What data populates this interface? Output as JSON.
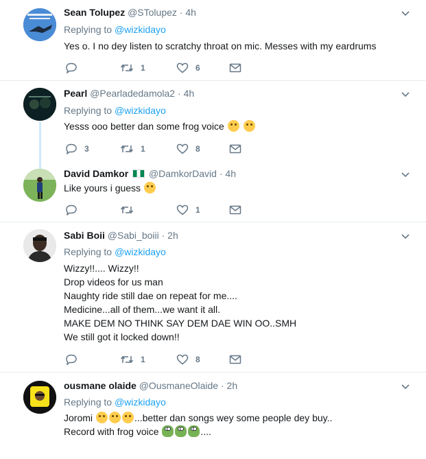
{
  "tweets": [
    {
      "name": "Sean Tolupez",
      "handle": "@STolupez",
      "time": "4h",
      "replying_label": "Replying to",
      "replying_to": "@wizkidayo",
      "lines": [
        "Yes o. I no dey listen to scratchy throat on mic. Messes with my eardrums"
      ],
      "replies": "",
      "retweets": "1",
      "likes": "6"
    },
    {
      "name": "Pearl",
      "handle": "@Pearladedamola2",
      "time": "4h",
      "replying_label": "Replying to",
      "replying_to": "@wizkidayo",
      "lines": [
        "Yesss ooo better dan some frog voice"
      ],
      "replies": "3",
      "retweets": "1",
      "likes": "8"
    },
    {
      "name": "David Damkor",
      "handle": "@DamkorDavid",
      "time": "4h",
      "lines": [
        "Like yours i guess"
      ],
      "replies": "",
      "retweets": "",
      "likes": "1"
    },
    {
      "name": "Sabi Boii",
      "handle": "@Sabi_boiii",
      "time": "2h",
      "replying_label": "Replying to",
      "replying_to": "@wizkidayo",
      "lines": [
        "Wizzy!!.... Wizzy!!",
        "Drop videos for us man",
        "Naughty ride still dae on repeat for me....",
        "Medicine...all of them...we want it all.",
        "MAKE DEM NO THINK SAY DEM DAE WIN OO..SMH",
        "We still got it locked down!!"
      ],
      "replies": "",
      "retweets": "1",
      "likes": "8"
    },
    {
      "name": "ousmane olaide",
      "handle": "@OusmaneOlaide",
      "time": "2h",
      "replying_label": "Replying to",
      "replying_to": "@wizkidayo",
      "lines": [
        "Joromi",
        "...better dan songs wey some people dey buy..",
        "Record with frog voice",
        "...."
      ]
    }
  ],
  "colors": {
    "link": "#1da1f2",
    "muted": "#657786",
    "text": "#14171a",
    "thread_line": "#cfe9fb"
  },
  "icons": {
    "reply": "reply-icon",
    "retweet": "retweet-icon",
    "like": "heart-icon",
    "message": "envelope-icon",
    "more": "chevron-down-icon",
    "flag": "nigeria-flag-icon"
  }
}
